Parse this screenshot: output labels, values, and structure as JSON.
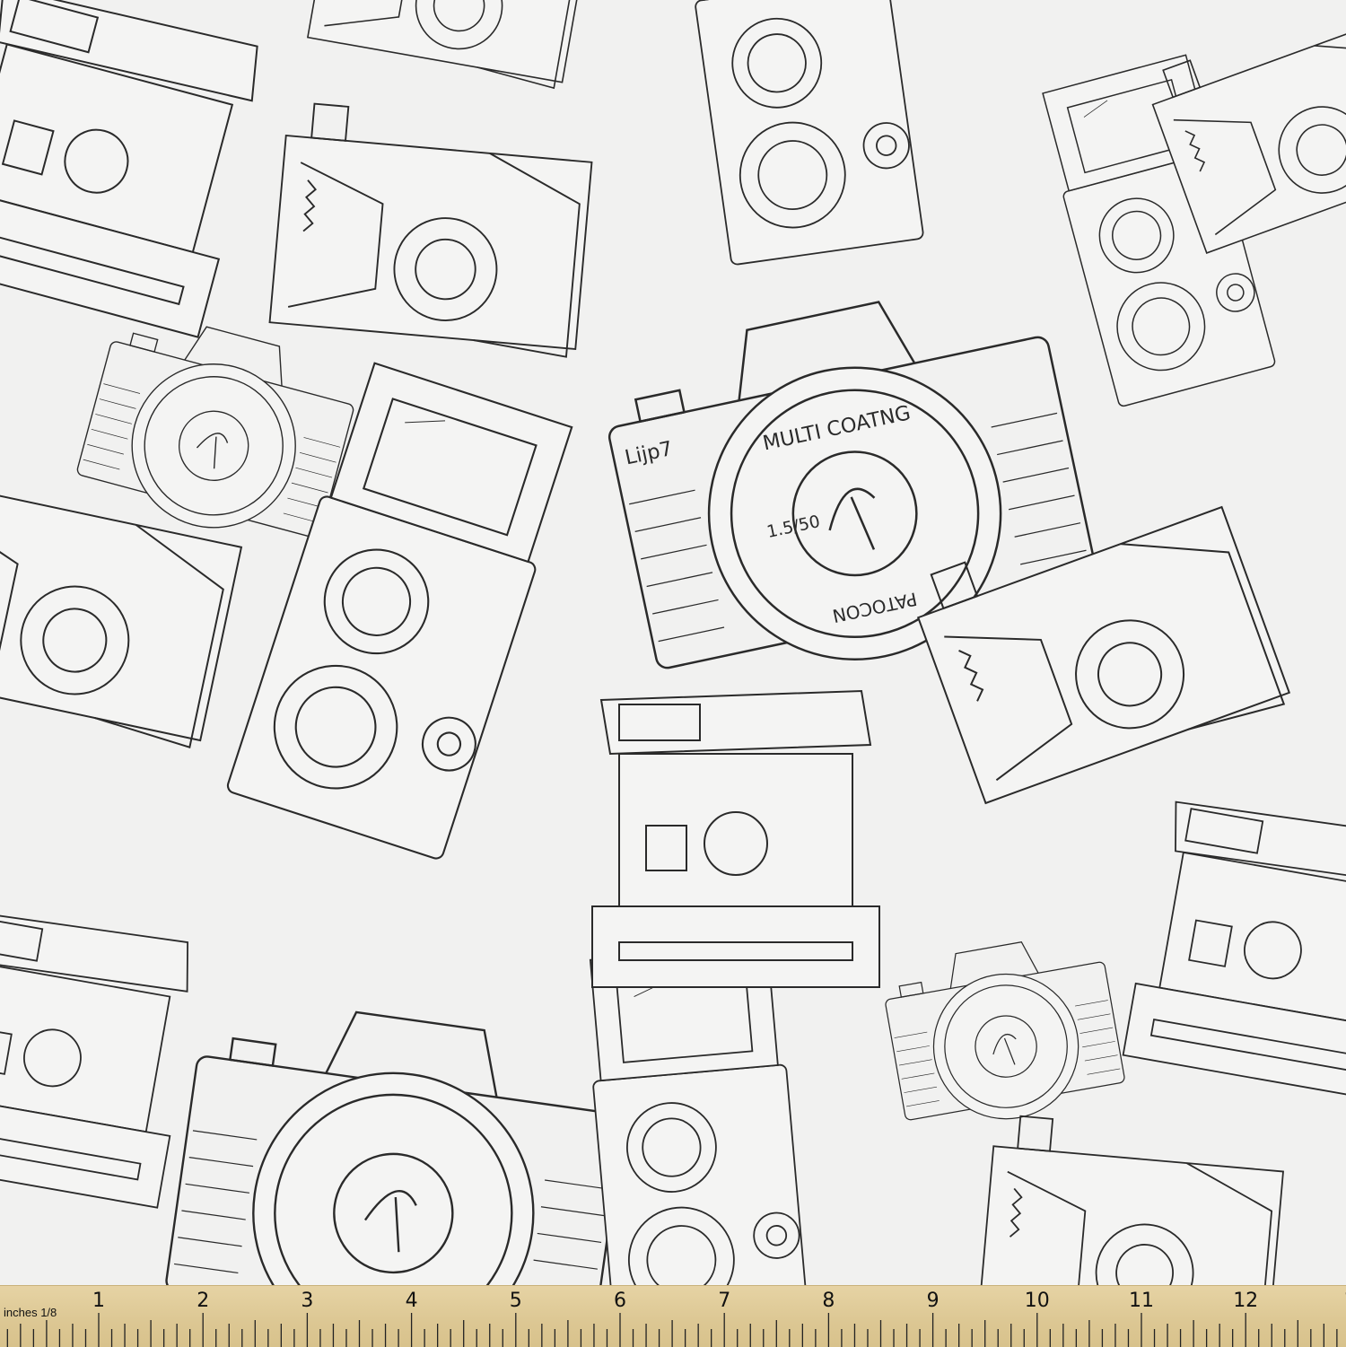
{
  "fabric": {
    "background_color": "#f1f1f0",
    "line_color": "#2a2a2a",
    "lens_text": [
      "MULTI COATNG",
      "1.5/50",
      "PATOCON"
    ],
    "brand_text": "Lijp7"
  },
  "ruler": {
    "unit_label": "inches 1/8",
    "numbers": [
      "1",
      "2",
      "3",
      "4",
      "5",
      "6",
      "7",
      "8",
      "9",
      "10",
      "11",
      "12",
      "1"
    ]
  }
}
